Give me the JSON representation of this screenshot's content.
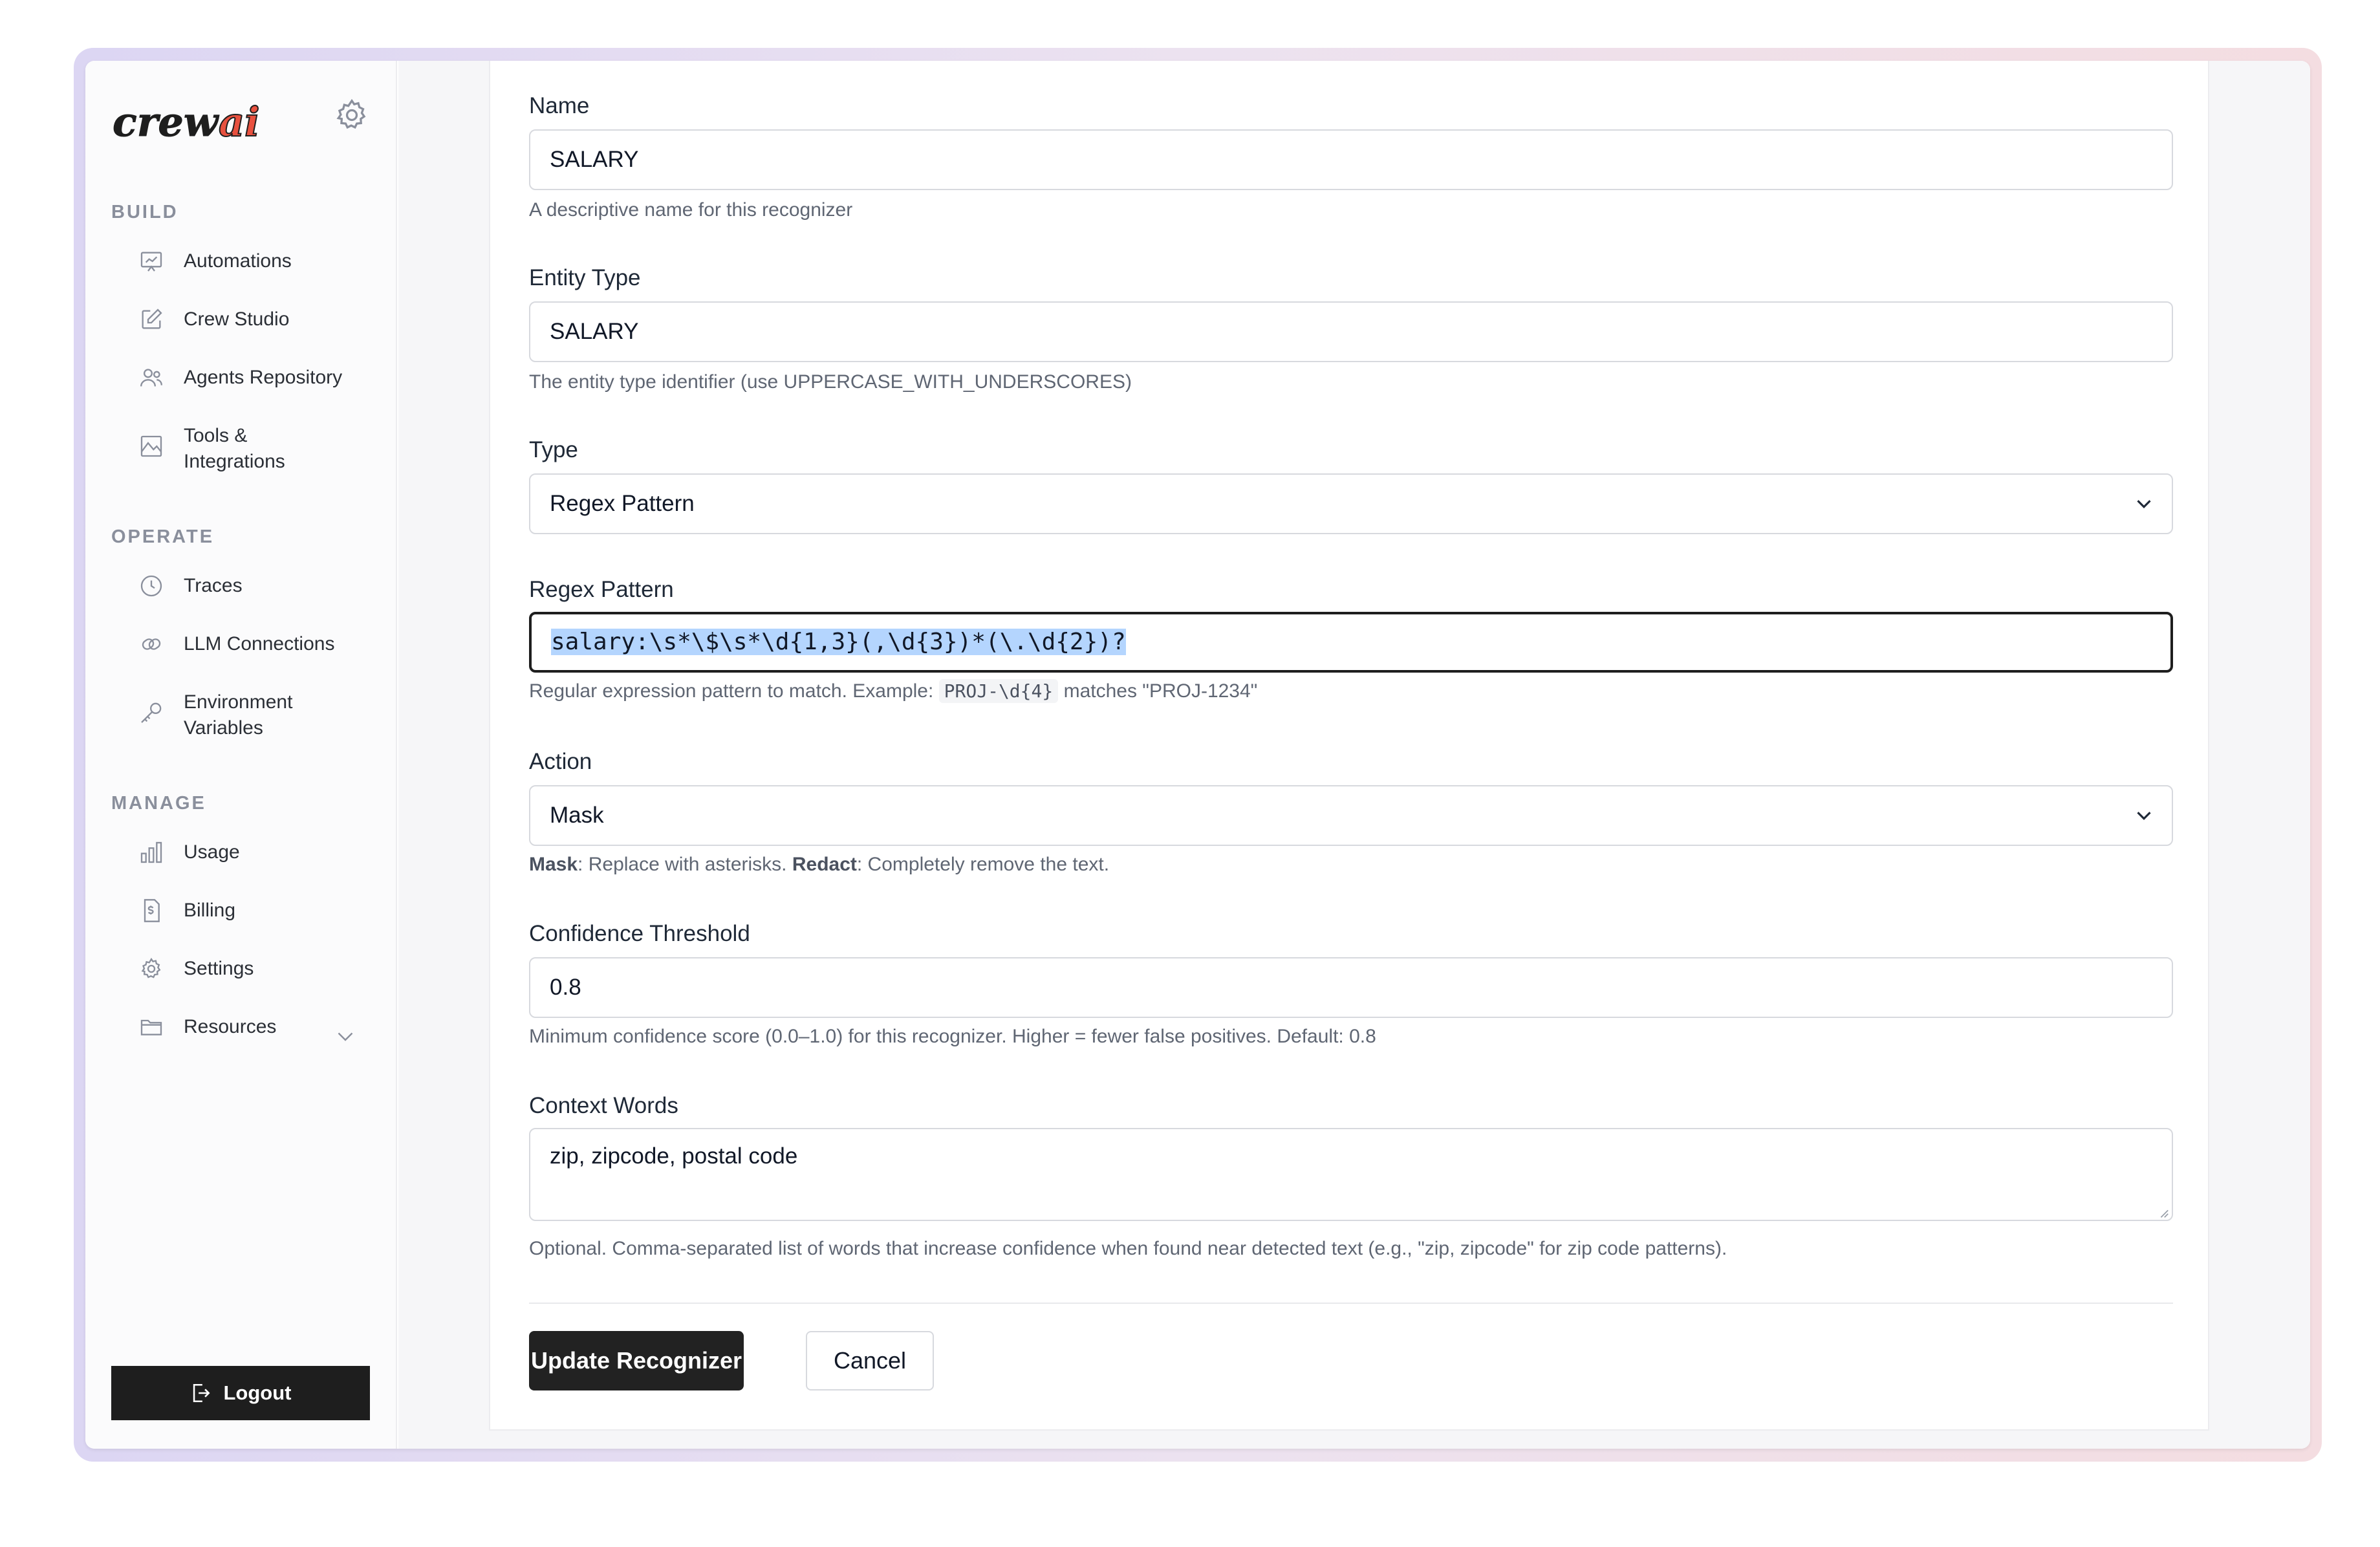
{
  "sidebar": {
    "logo_text": "crewai",
    "sections": {
      "build": "BUILD",
      "operate": "OPERATE",
      "manage": "MANAGE"
    },
    "build_items": [
      {
        "label": "Automations",
        "icon": "chart-board-icon"
      },
      {
        "label": "Crew Studio",
        "icon": "pencil-square-icon"
      },
      {
        "label": "Agents Repository",
        "icon": "users-icon"
      },
      {
        "label": "Tools & Integrations",
        "icon": "image-box-icon"
      }
    ],
    "operate_items": [
      {
        "label": "Traces",
        "icon": "clock-icon"
      },
      {
        "label": "LLM Connections",
        "icon": "link-icon"
      },
      {
        "label": "Environment Variables",
        "icon": "key-icon"
      }
    ],
    "manage_items": [
      {
        "label": "Usage",
        "icon": "bar-chart-icon"
      },
      {
        "label": "Billing",
        "icon": "invoice-icon"
      },
      {
        "label": "Settings",
        "icon": "gear-icon"
      },
      {
        "label": "Resources",
        "icon": "folder-icon"
      }
    ],
    "logout_label": "Logout"
  },
  "form": {
    "name": {
      "label": "Name",
      "value": "SALARY",
      "hint": "A descriptive name for this recognizer"
    },
    "entity_type": {
      "label": "Entity Type",
      "value": "SALARY",
      "hint": "The entity type identifier (use UPPERCASE_WITH_UNDERSCORES)"
    },
    "type": {
      "label": "Type",
      "value": "Regex Pattern"
    },
    "regex": {
      "label": "Regex Pattern",
      "value": "salary:\\s*\\$\\s*\\d{1,3}(,\\d{3})*(\\.\\d{2})?",
      "hint_prefix": "Regular expression pattern to match. Example:",
      "hint_code": "PROJ-\\d{4}",
      "hint_suffix": "matches \"PROJ-1234\""
    },
    "action": {
      "label": "Action",
      "value": "Mask",
      "hint_mask_term": "Mask",
      "hint_mask_text": ": Replace with asterisks.",
      "hint_redact_term": "Redact",
      "hint_redact_text": ": Completely remove the text."
    },
    "confidence": {
      "label": "Confidence Threshold",
      "value": "0.8",
      "hint": "Minimum confidence score (0.0–1.0) for this recognizer. Higher = fewer false positives. Default: 0.8"
    },
    "context": {
      "label": "Context Words",
      "value": "zip, zipcode, postal code",
      "hint": "Optional. Comma-separated list of words that increase confidence when found near detected text (e.g., \"zip, zipcode\" for zip code patterns)."
    },
    "submit_label": "Update Recognizer",
    "cancel_label": "Cancel"
  }
}
